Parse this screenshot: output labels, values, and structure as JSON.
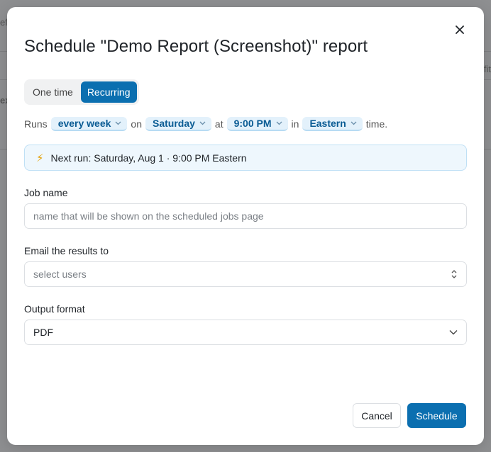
{
  "background": {
    "fragments": [
      "efi",
      "fit",
      "ex"
    ]
  },
  "modal": {
    "title": "Schedule \"Demo Report (Screenshot)\" report",
    "close_icon": "close-icon",
    "frequency_toggle": {
      "options": [
        {
          "label": "One time",
          "active": false
        },
        {
          "label": "Recurring",
          "active": true
        }
      ]
    },
    "schedule_sentence": {
      "runs": "Runs",
      "interval": "every week",
      "on": "on",
      "day": "Saturday",
      "at": "at",
      "time": "9:00 PM",
      "in": "in",
      "timezone": "Eastern",
      "suffix": "time."
    },
    "next_run": {
      "icon": "bolt-icon",
      "text": "Next run: Saturday, Aug 1 · 9:00 PM Eastern"
    },
    "job_name": {
      "label": "Job name",
      "value": "",
      "placeholder": "name that will be shown on the scheduled jobs page"
    },
    "email": {
      "label": "Email the results to",
      "placeholder": "select users"
    },
    "output_format": {
      "label": "Output format",
      "value": "PDF"
    },
    "buttons": {
      "cancel": "Cancel",
      "schedule": "Schedule"
    }
  },
  "colors": {
    "accent": "#0b6fb0",
    "pill_bg": "#e3f1fb",
    "info_bg": "#eef7fd"
  }
}
